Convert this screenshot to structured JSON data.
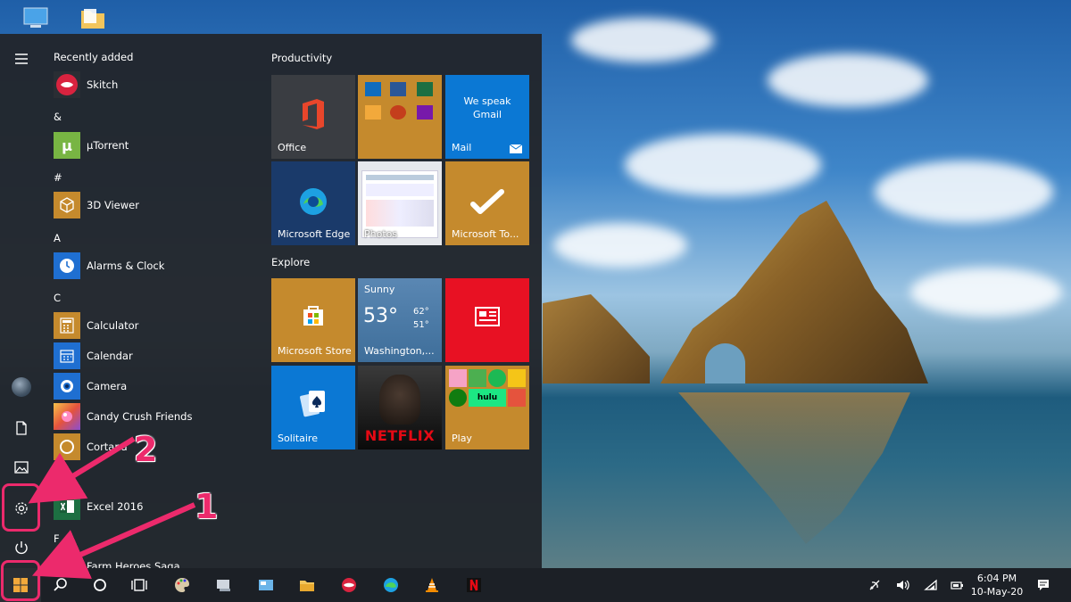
{
  "start_menu": {
    "recently_added_label": "Recently added",
    "apps": [
      {
        "label": "Skitch",
        "icon": "skitch-icon",
        "color": "#d9233f"
      },
      {
        "label": "µTorrent",
        "icon": "utorrent-icon",
        "color": "#78b543"
      },
      {
        "label": "3D Viewer",
        "icon": "3d-viewer-icon",
        "color": "#c58a2d"
      },
      {
        "label": "Alarms & Clock",
        "icon": "alarms-clock-icon",
        "color": "#1f6fd1"
      },
      {
        "label": "Calculator",
        "icon": "calculator-icon",
        "color": "#c58a2d"
      },
      {
        "label": "Calendar",
        "icon": "calendar-icon",
        "color": "#1f6fd1"
      },
      {
        "label": "Camera",
        "icon": "camera-icon",
        "color": "#1f6fd1"
      },
      {
        "label": "Candy Crush Friends",
        "icon": "candy-crush-icon",
        "color": "#e89a35"
      },
      {
        "label": "Cortana",
        "icon": "cortana-icon",
        "color": "#c58a2d"
      },
      {
        "label": "Excel 2016",
        "icon": "excel-icon",
        "color": "#1d6f42"
      },
      {
        "label": "Farm Heroes Saga",
        "icon": "farm-heroes-icon",
        "color": "#8a4a20"
      }
    ],
    "letters": {
      "amp": "&",
      "hash": "#",
      "a": "A",
      "c": "C",
      "f": "F"
    }
  },
  "tiles": {
    "productivity_label": "Productivity",
    "explore_label": "Explore",
    "office": "Office",
    "mail_top": "We speak",
    "mail_mid": "Gmail",
    "mail": "Mail",
    "edge": "Microsoft Edge",
    "photos": "Photos",
    "todo": "Microsoft To...",
    "store": "Microsoft Store",
    "weather_cond": "Sunny",
    "weather_temp": "53°",
    "weather_hi": "62°",
    "weather_lo": "51°",
    "weather_city": "Washington,...",
    "solitaire": "Solitaire",
    "netflix": "NETFLIX",
    "play": "Play",
    "hulu": "hulu"
  },
  "taskbar": {
    "time": "6:04 PM",
    "date": "10-May-20"
  },
  "annotations": {
    "one": "1",
    "two": "2"
  },
  "colors": {
    "accent": "#ec2a6c",
    "tile_gold": "#c58a2d",
    "tile_blue": "#0b78d4",
    "tile_red": "#e81123"
  }
}
